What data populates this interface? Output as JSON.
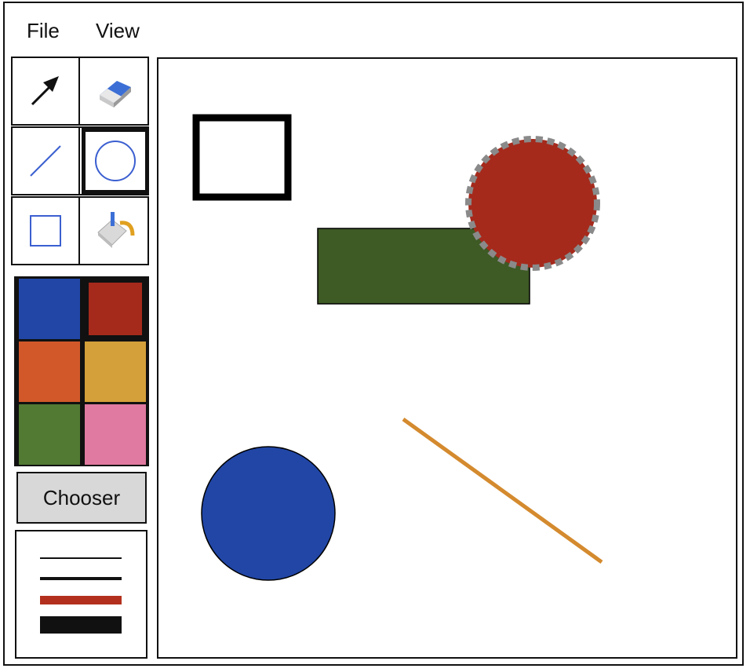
{
  "menu": {
    "file_label": "File",
    "view_label": "View"
  },
  "tools": [
    {
      "name": "pointer",
      "icon": "arrow-pointer-icon",
      "selected": false
    },
    {
      "name": "eraser",
      "icon": "eraser-icon",
      "selected": false
    },
    {
      "name": "line",
      "icon": "line-tool-icon",
      "selected": false
    },
    {
      "name": "ellipse",
      "icon": "circle-tool-icon",
      "selected": true
    },
    {
      "name": "rectangle",
      "icon": "rectangle-tool-icon",
      "selected": false
    },
    {
      "name": "fill",
      "icon": "paint-bucket-icon",
      "selected": false
    }
  ],
  "palette": {
    "colors": [
      "#2146a6",
      "#a52a1c",
      "#d2582a",
      "#d4a03a",
      "#527a33",
      "#e07aa0"
    ],
    "selected_index": 1
  },
  "chooser": {
    "label": "Chooser"
  },
  "line_widths": {
    "option_count": 4,
    "colors": [
      "#111111",
      "#111111",
      "#b3301e",
      "#111111"
    ]
  },
  "canvas": {
    "shapes": [
      {
        "type": "rectangle",
        "fill": "none",
        "stroke": "#000000",
        "stroke_style": "thick"
      },
      {
        "type": "rectangle",
        "fill": "#3e5a25",
        "stroke": "#000000",
        "stroke_style": "thin"
      },
      {
        "type": "circle",
        "fill": "#a52a1c",
        "stroke": "#8a8a8a",
        "stroke_style": "dashed",
        "selected": true
      },
      {
        "type": "circle",
        "fill": "#2146a6",
        "stroke": "#000000",
        "stroke_style": "thin"
      },
      {
        "type": "line",
        "stroke": "#d48a2e",
        "stroke_style": "medium"
      }
    ]
  }
}
